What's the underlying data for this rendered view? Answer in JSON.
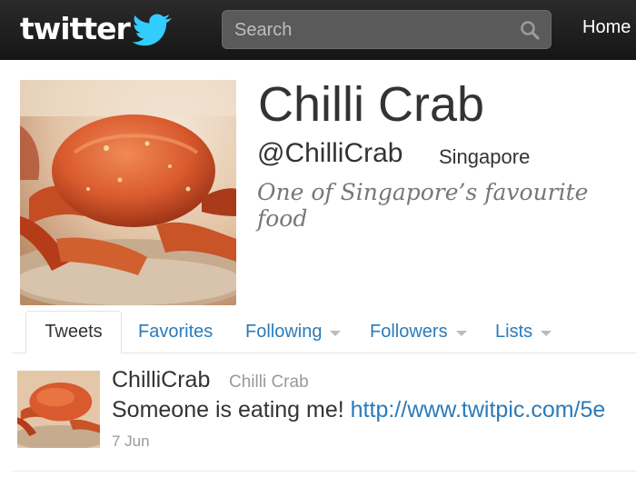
{
  "header": {
    "logo_text": "twitter",
    "search_placeholder": "Search",
    "home_label": "Home"
  },
  "profile": {
    "name": "Chilli Crab",
    "screen_name": "@ChilliCrab",
    "location": "Singapore",
    "bio": "One of Singapore’s favourite food"
  },
  "tabs": [
    {
      "label": "Tweets",
      "active": true
    },
    {
      "label": "Favorites",
      "active": false
    },
    {
      "label": "Following",
      "active": false
    },
    {
      "label": "Followers",
      "active": false
    },
    {
      "label": "Lists",
      "active": false
    }
  ],
  "tweet": {
    "username": "ChilliCrab",
    "fullname": "Chilli Crab",
    "text": "Someone is eating me!",
    "link": "http://www.twitpic.com/5e",
    "date": "7 Jun"
  },
  "colors": {
    "link": "#2b7bb9",
    "topbar": "#1c1c1c",
    "bird": "#33ccff"
  }
}
